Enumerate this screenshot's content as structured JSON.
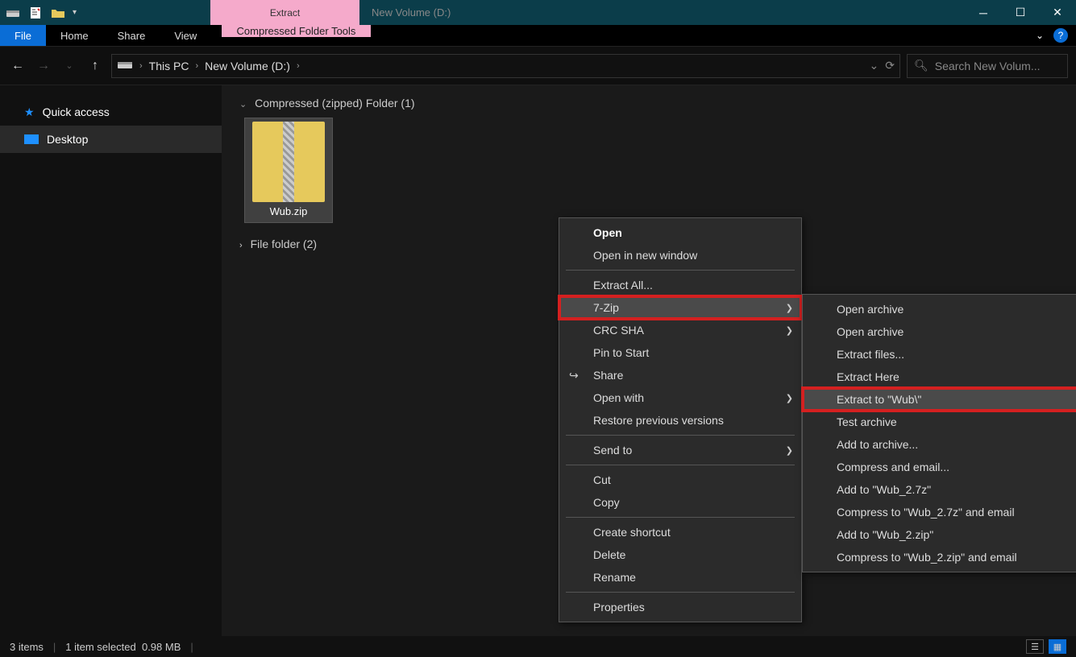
{
  "titlebar": {
    "tool_tab": "Extract",
    "window_title": "New Volume (D:)"
  },
  "ribbon": {
    "file": "File",
    "tabs": [
      "Home",
      "Share",
      "View"
    ],
    "tool_tab": "Compressed Folder Tools"
  },
  "nav": {
    "crumbs": [
      "This PC",
      "New Volume (D:)"
    ],
    "search_placeholder": "Search New Volum..."
  },
  "sidebar": {
    "quick_access": "Quick access",
    "desktop": "Desktop"
  },
  "content": {
    "group1": "Compressed (zipped) Folder (1)",
    "file_name": "Wub.zip",
    "group2": "File folder (2)"
  },
  "context_menu": {
    "items": [
      {
        "label": "Open",
        "bold": true
      },
      {
        "label": "Open in new window"
      },
      {
        "sep": true
      },
      {
        "label": "Extract All..."
      },
      {
        "label": "7-Zip",
        "arrow": true,
        "highlight": true,
        "hover": true
      },
      {
        "label": "CRC SHA",
        "arrow": true
      },
      {
        "label": "Pin to Start"
      },
      {
        "label": "Share",
        "icon": "↪"
      },
      {
        "label": "Open with",
        "arrow": true
      },
      {
        "label": "Restore previous versions"
      },
      {
        "sep": true
      },
      {
        "label": "Send to",
        "arrow": true
      },
      {
        "sep": true
      },
      {
        "label": "Cut"
      },
      {
        "label": "Copy"
      },
      {
        "sep": true
      },
      {
        "label": "Create shortcut"
      },
      {
        "label": "Delete"
      },
      {
        "label": "Rename"
      },
      {
        "sep": true
      },
      {
        "label": "Properties"
      }
    ]
  },
  "submenu": {
    "items": [
      {
        "label": "Open archive"
      },
      {
        "label": "Open archive",
        "arrow": true
      },
      {
        "label": "Extract files..."
      },
      {
        "label": "Extract Here"
      },
      {
        "label": "Extract to \"Wub\\\"",
        "highlight": true,
        "hover": true
      },
      {
        "label": "Test archive"
      },
      {
        "label": "Add to archive..."
      },
      {
        "label": "Compress and email..."
      },
      {
        "label": "Add to \"Wub_2.7z\""
      },
      {
        "label": "Compress to \"Wub_2.7z\" and email"
      },
      {
        "label": "Add to \"Wub_2.zip\""
      },
      {
        "label": "Compress to \"Wub_2.zip\" and email"
      }
    ]
  },
  "statusbar": {
    "items": "3 items",
    "selected": "1 item selected",
    "size": "0.98 MB"
  }
}
